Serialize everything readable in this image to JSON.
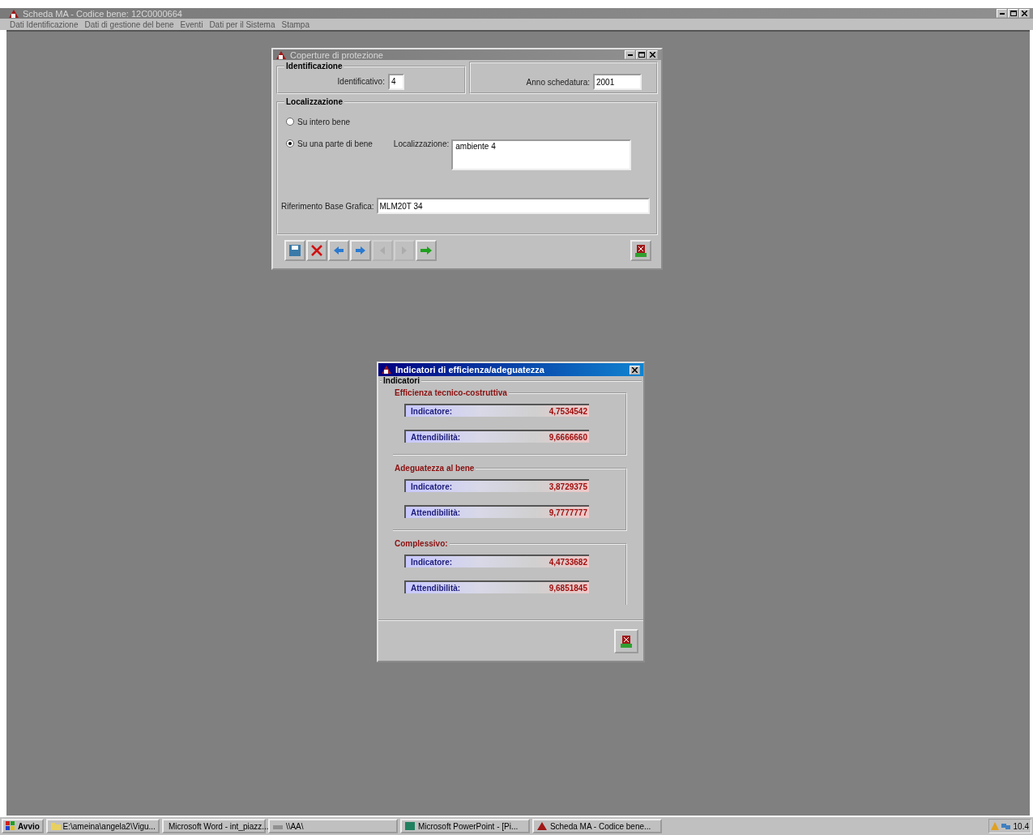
{
  "app_window": {
    "title": "Scheda MA - Codice bene: 12C0000664",
    "menu": [
      "Dati Identificazione",
      "Dati di gestione del bene",
      "Eventi",
      "Dati per il Sistema",
      "Stampa"
    ]
  },
  "protection_window": {
    "title": "Coperture di protezione",
    "identification": {
      "legend": "Identificazione",
      "id_label": "Identificativo:",
      "id_value": "4",
      "year_label": "Anno schedatura:",
      "year_value": "2001"
    },
    "localization": {
      "legend": "Localizzazione",
      "options": [
        {
          "label": "Su intero bene",
          "selected": false
        },
        {
          "label": "Su una parte di bene",
          "selected": true
        }
      ],
      "loc_label": "Localizzazione:",
      "loc_value": "ambiente 4",
      "ref_label": "Riferimento Base Grafica:",
      "ref_value": "MLM20T 34"
    },
    "toolbar": [
      {
        "kind": "save",
        "disabled": false
      },
      {
        "kind": "delete",
        "disabled": false
      },
      {
        "kind": "back",
        "disabled": false
      },
      {
        "kind": "forward",
        "disabled": false
      },
      {
        "kind": "prev",
        "disabled": true
      },
      {
        "kind": "next",
        "disabled": true
      },
      {
        "kind": "go",
        "disabled": false
      }
    ]
  },
  "indicators_window": {
    "title": "Indicatori di efficienza/adeguatezza",
    "legend": "Indicatori",
    "groups": [
      {
        "legend": "Efficienza tecnico-costruttiva",
        "rows": [
          {
            "label": "Indicatore:",
            "value": "4,7534542"
          },
          {
            "label": "Attendibilità:",
            "value": "9,6666660"
          }
        ]
      },
      {
        "legend": "Adeguatezza al bene",
        "rows": [
          {
            "label": "Indicatore:",
            "value": "3,8729375"
          },
          {
            "label": "Attendibilità:",
            "value": "9,7777777"
          }
        ]
      },
      {
        "legend": "Complessivo:",
        "rows": [
          {
            "label": "Indicatore:",
            "value": "4,4733682"
          },
          {
            "label": "Attendibilità:",
            "value": "9,6851845"
          }
        ]
      }
    ]
  },
  "taskbar": {
    "start": "Avvio",
    "tasks": [
      {
        "label": "E:\\ameina\\angela2\\Vigu...",
        "kind": "folder",
        "selected": false
      },
      {
        "label": "Microsoft Word - int_piazz...",
        "kind": "word",
        "selected": false
      },
      {
        "label": "\\\\AA\\",
        "kind": "network",
        "selected": false
      },
      {
        "label": "Microsoft PowerPoint - [Pi...",
        "kind": "powerpoint",
        "selected": false
      },
      {
        "label": "Scheda MA - Codice bene...",
        "kind": "app",
        "selected": false
      }
    ],
    "clock": "10.4"
  }
}
